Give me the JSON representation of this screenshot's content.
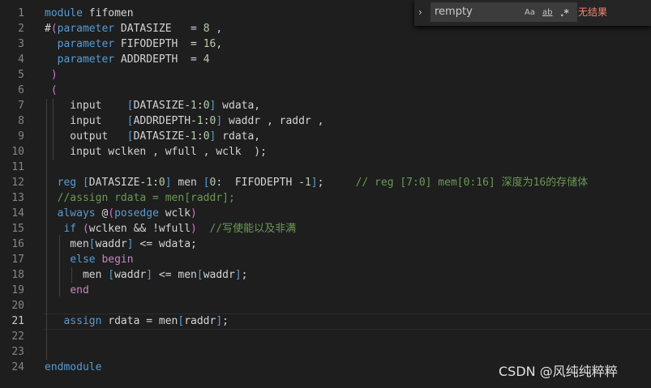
{
  "editor": {
    "active_line": "21",
    "lines": [
      {
        "n": "1",
        "segs": [
          [
            "kb",
            "module"
          ],
          [
            "id",
            " fifomen"
          ]
        ]
      },
      {
        "n": "2",
        "segs": [
          [
            "id",
            "#"
          ],
          [
            "br",
            "("
          ],
          [
            "kb",
            "parameter"
          ],
          [
            "id",
            " DATASIZE   = "
          ],
          [
            "nm",
            "8"
          ],
          [
            "id",
            " ,"
          ]
        ]
      },
      {
        "n": "3",
        "segs": [
          [
            "id",
            "  "
          ],
          [
            "kb",
            "parameter"
          ],
          [
            "id",
            " FIFODEPTH  = "
          ],
          [
            "nm",
            "16"
          ],
          [
            "id",
            ","
          ]
        ]
      },
      {
        "n": "4",
        "segs": [
          [
            "id",
            "  "
          ],
          [
            "kb",
            "parameter"
          ],
          [
            "id",
            " ADDRDEPTH  = "
          ],
          [
            "nm",
            "4"
          ]
        ]
      },
      {
        "n": "5",
        "segs": [
          [
            "id",
            " "
          ],
          [
            "br",
            ")"
          ]
        ]
      },
      {
        "n": "6",
        "segs": [
          [
            "id",
            " "
          ],
          [
            "br",
            "("
          ]
        ]
      },
      {
        "n": "7",
        "segs": [
          [
            "id",
            "    input    "
          ],
          [
            "kb",
            "["
          ],
          [
            "id",
            "DATASIZE-"
          ],
          [
            "nm",
            "1"
          ],
          [
            "id",
            ":"
          ],
          [
            "nm",
            "0"
          ],
          [
            "kb",
            "]"
          ],
          [
            "id",
            " wdata,"
          ]
        ]
      },
      {
        "n": "8",
        "segs": [
          [
            "id",
            "    input    "
          ],
          [
            "kb",
            "["
          ],
          [
            "id",
            "ADDRDEPTH-"
          ],
          [
            "nm",
            "1"
          ],
          [
            "id",
            ":"
          ],
          [
            "nm",
            "0"
          ],
          [
            "kb",
            "]"
          ],
          [
            "id",
            " waddr , raddr ,"
          ]
        ]
      },
      {
        "n": "9",
        "segs": [
          [
            "id",
            "    output   "
          ],
          [
            "kb",
            "["
          ],
          [
            "id",
            "DATASIZE-"
          ],
          [
            "nm",
            "1"
          ],
          [
            "id",
            ":"
          ],
          [
            "nm",
            "0"
          ],
          [
            "kb",
            "]"
          ],
          [
            "id",
            " rdata,"
          ]
        ]
      },
      {
        "n": "10",
        "segs": [
          [
            "id",
            "    input wclken , wfull , wclk  );"
          ]
        ]
      },
      {
        "n": "11",
        "segs": []
      },
      {
        "n": "12",
        "segs": [
          [
            "id",
            "  "
          ],
          [
            "kb",
            "reg"
          ],
          [
            "id",
            " "
          ],
          [
            "kb",
            "["
          ],
          [
            "id",
            "DATASIZE-"
          ],
          [
            "nm",
            "1"
          ],
          [
            "id",
            ":"
          ],
          [
            "nm",
            "0"
          ],
          [
            "kb",
            "]"
          ],
          [
            "id",
            " men "
          ],
          [
            "kb",
            "["
          ],
          [
            "nm",
            "0"
          ],
          [
            "id",
            ":  FIFODEPTH -"
          ],
          [
            "nm",
            "1"
          ],
          [
            "kb",
            "]"
          ],
          [
            "id",
            ";     "
          ],
          [
            "cm",
            "// reg [7:0] mem[0:16] 深度为16的存储体"
          ]
        ]
      },
      {
        "n": "13",
        "segs": [
          [
            "id",
            "  "
          ],
          [
            "cm",
            "//assign rdata = men[raddr];"
          ]
        ]
      },
      {
        "n": "14",
        "segs": [
          [
            "id",
            "  "
          ],
          [
            "kb",
            "always"
          ],
          [
            "id",
            " @"
          ],
          [
            "br",
            "("
          ],
          [
            "kb",
            "posedge"
          ],
          [
            "id",
            " wclk"
          ],
          [
            "br",
            ")"
          ]
        ]
      },
      {
        "n": "15",
        "segs": [
          [
            "id",
            "   "
          ],
          [
            "kb",
            "if"
          ],
          [
            "id",
            " "
          ],
          [
            "br",
            "("
          ],
          [
            "id",
            "wclken && !wfull"
          ],
          [
            "br",
            ")"
          ],
          [
            "id",
            "  "
          ],
          [
            "cm",
            "//写使能以及非满"
          ]
        ]
      },
      {
        "n": "16",
        "segs": [
          [
            "id",
            "    men"
          ],
          [
            "kb",
            "["
          ],
          [
            "id",
            "waddr"
          ],
          [
            "kb",
            "]"
          ],
          [
            "id",
            " <= wdata;"
          ]
        ]
      },
      {
        "n": "17",
        "segs": [
          [
            "id",
            "    "
          ],
          [
            "kb",
            "else"
          ],
          [
            "id",
            " "
          ],
          [
            "kw",
            "begin"
          ]
        ]
      },
      {
        "n": "18",
        "segs": [
          [
            "id",
            "      men "
          ],
          [
            "kb",
            "["
          ],
          [
            "id",
            "waddr"
          ],
          [
            "kb",
            "]"
          ],
          [
            "id",
            " <= men"
          ],
          [
            "kb",
            "["
          ],
          [
            "id",
            "waddr"
          ],
          [
            "kb",
            "]"
          ],
          [
            "id",
            ";"
          ]
        ]
      },
      {
        "n": "19",
        "segs": [
          [
            "id",
            "    "
          ],
          [
            "kw",
            "end"
          ]
        ]
      },
      {
        "n": "20",
        "segs": []
      },
      {
        "n": "21",
        "segs": [
          [
            "id",
            "   "
          ],
          [
            "kb",
            "assign"
          ],
          [
            "id",
            " rdata = men"
          ],
          [
            "kb",
            "["
          ],
          [
            "id",
            "raddr"
          ],
          [
            "kb",
            "]"
          ],
          [
            "id",
            ";"
          ]
        ]
      },
      {
        "n": "22",
        "segs": []
      },
      {
        "n": "23",
        "segs": []
      },
      {
        "n": "24",
        "segs": [
          [
            "kb",
            "endmodule"
          ]
        ]
      }
    ]
  },
  "find_widget": {
    "toggle_icon": "chevron-right-icon",
    "toggle_glyph": "›",
    "query": "rempty",
    "match_case_label": "Aa",
    "whole_word_label": "ab",
    "regex_label": ".*",
    "result_text": "无结果",
    "result_color": "#f48771"
  },
  "watermark": {
    "text": "CSDN @风纯纯粹粹"
  },
  "colors": {
    "background": "#1e1e1e",
    "keyword_blue": "#569cd6",
    "keyword_purple": "#c586c0",
    "comment": "#6a9955",
    "number": "#b5cea8",
    "bracket": "#da70d6",
    "text": "#d4d4d4"
  }
}
